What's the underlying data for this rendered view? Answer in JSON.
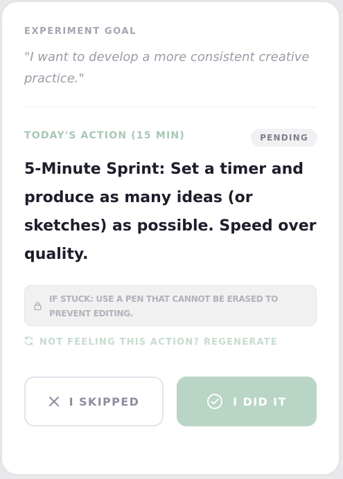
{
  "goal": {
    "label": "EXPERIMENT GOAL",
    "quote": "\"I want to develop a more consistent creative practice.\""
  },
  "action": {
    "label": "TODAY'S ACTION (15 MIN)",
    "status": "PENDING",
    "text": "5-Minute Sprint: Set a timer and produce as many ideas (or sketches) as possible. Speed over quality."
  },
  "hint": {
    "icon": "lock-icon",
    "text": "IF STUCK: USE A PEN THAT CANNOT BE ERASED TO PREVENT EDITING."
  },
  "regenerate": {
    "icon": "refresh-icon",
    "label": "NOT FEELING THIS ACTION? REGENERATE"
  },
  "buttons": {
    "skip_icon": "close-icon",
    "skip_label": "I SKIPPED",
    "done_icon": "check-circle-icon",
    "done_label": "I DID IT"
  },
  "colors": {
    "accent_green": "#b9d5c5",
    "label_green": "#a6c7b4",
    "text_dark": "#1d1d2b"
  }
}
